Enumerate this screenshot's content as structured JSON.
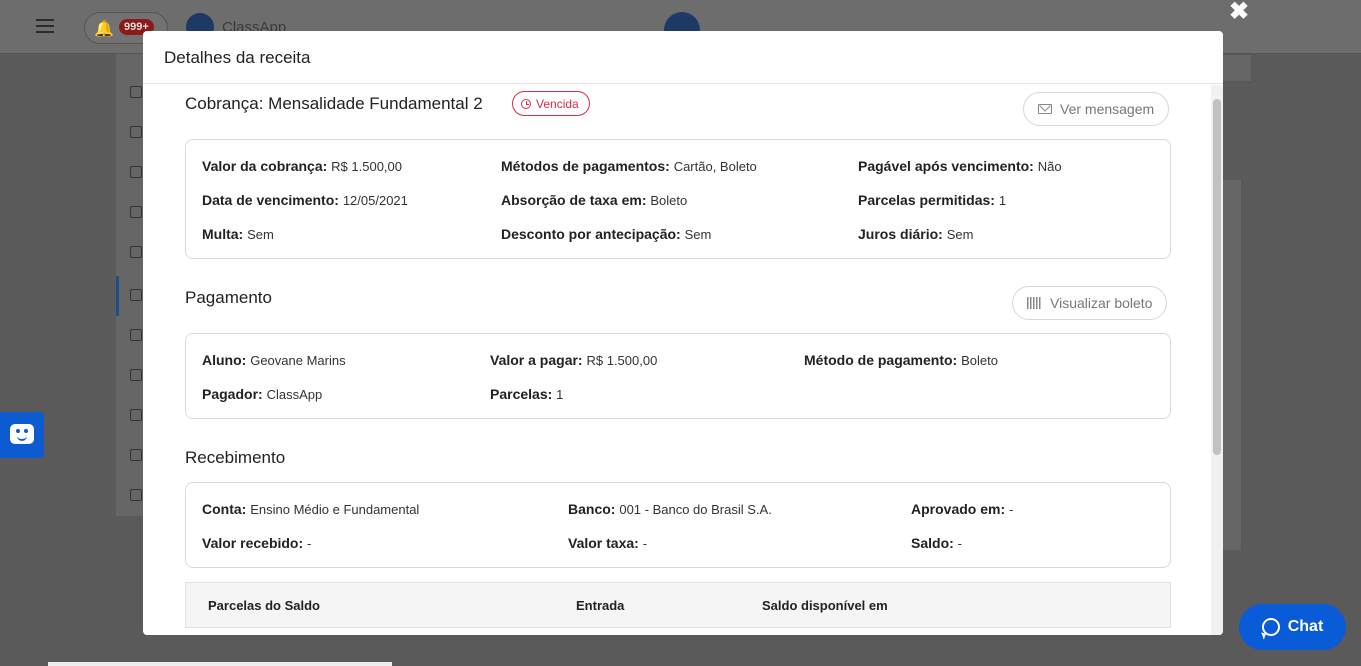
{
  "background": {
    "app_name": "ClassApp",
    "notification_badge": "999+"
  },
  "modal": {
    "title": "Detalhes da receita",
    "close_symbol": "✖"
  },
  "cobranca": {
    "title": "Cobrança: Mensalidade Fundamental 2",
    "status": "Vencida",
    "status_color": "#db2b4a",
    "button_label": "Ver mensagem",
    "fields": [
      {
        "label": "Valor da cobrança:",
        "value": "R$ 1.500,00"
      },
      {
        "label": "Métodos de pagamentos:",
        "value": "Cartão, Boleto"
      },
      {
        "label": "Pagável após vencimento:",
        "value": "Não"
      },
      {
        "label": "Data de vencimento:",
        "value": "12/05/2021"
      },
      {
        "label": "Absorção de taxa em:",
        "value": "Boleto"
      },
      {
        "label": "Parcelas permitidas:",
        "value": "1"
      },
      {
        "label": "Multa:",
        "value": "Sem"
      },
      {
        "label": "Desconto por antecipação:",
        "value": "Sem"
      },
      {
        "label": "Juros diário:",
        "value": "Sem"
      }
    ]
  },
  "pagamento": {
    "title": "Pagamento",
    "button_label": "Visualizar boleto",
    "fields": [
      {
        "label": "Aluno:",
        "value": "Geovane Marins"
      },
      {
        "label": "Valor a pagar:",
        "value": "R$ 1.500,00"
      },
      {
        "label": "Método de pagamento:",
        "value": "Boleto"
      },
      {
        "label": "Pagador:",
        "value": "ClassApp"
      },
      {
        "label": "Parcelas:",
        "value": "1"
      }
    ]
  },
  "recebimento": {
    "title": "Recebimento",
    "fields": [
      {
        "label": "Conta:",
        "value": "Ensino Médio e Fundamental"
      },
      {
        "label": "Banco:",
        "value": "001 - Banco do Brasil S.A."
      },
      {
        "label": "Aprovado em:",
        "value": "-"
      },
      {
        "label": "Valor recebido:",
        "value": "-"
      },
      {
        "label": "Valor taxa:",
        "value": "-"
      },
      {
        "label": "Saldo:",
        "value": "-"
      }
    ],
    "table_headers": [
      "Parcelas do Saldo",
      "Entrada",
      "Saldo disponível em"
    ]
  },
  "chat": {
    "label": "Chat",
    "color": "#0a5bd8"
  },
  "icons": [
    "hamburger-icon",
    "bell-icon",
    "clock-icon",
    "mail-icon",
    "barcode-icon",
    "chat-icon",
    "helper-icon",
    "close-icon"
  ]
}
